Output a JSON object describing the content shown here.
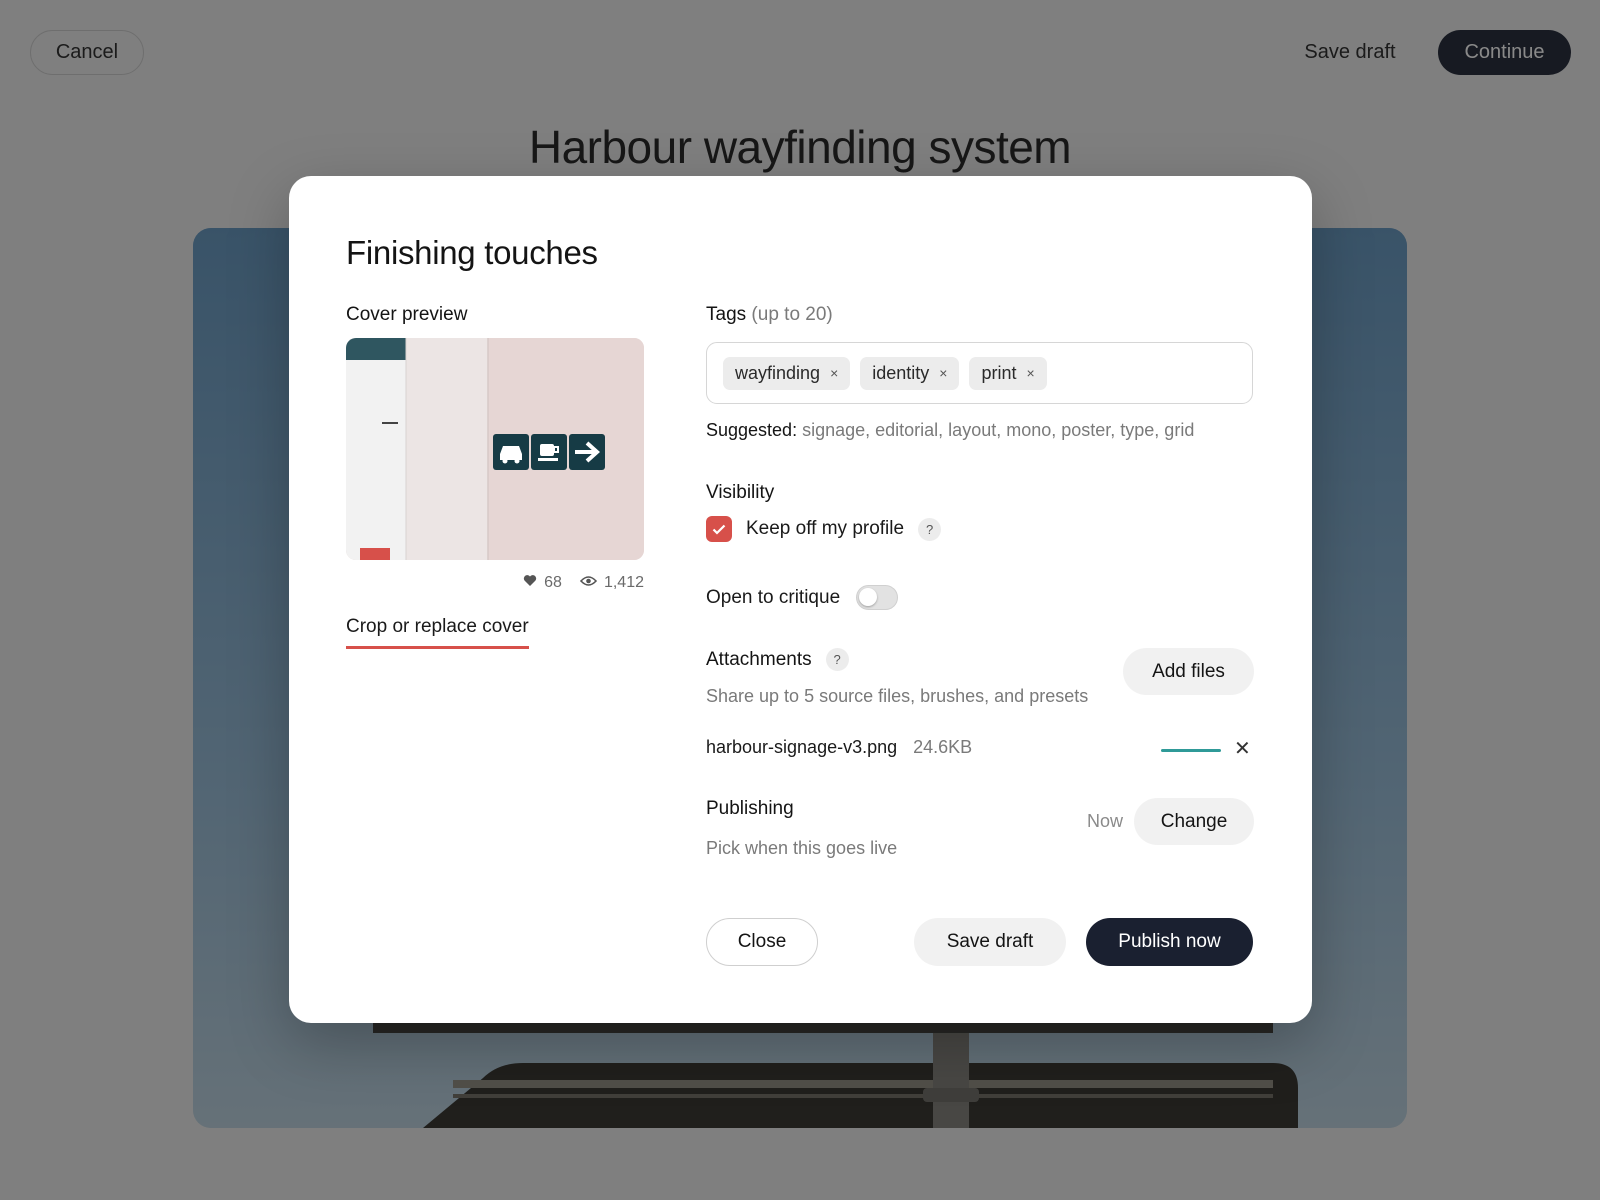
{
  "topbar": {
    "cancel_label": "Cancel",
    "save_draft_label": "Save draft",
    "continue_label": "Continue"
  },
  "project": {
    "title": "Harbour wayfinding system"
  },
  "modal": {
    "title": "Finishing touches",
    "cover": {
      "label": "Cover preview",
      "likes": "68",
      "views": "1,412",
      "crop_link": "Crop or replace cover"
    },
    "tags": {
      "label": "Tags",
      "hint": "(up to 20)",
      "items": [
        "wayfinding",
        "identity",
        "print"
      ],
      "remove_glyph": "×",
      "suggested_label": "Suggested:",
      "suggested_values": "signage, editorial, layout, mono, poster, type, grid"
    },
    "visibility": {
      "label": "Visibility",
      "keep_off_profile_label": "Keep off my profile",
      "keep_off_profile_checked": true,
      "help_glyph": "?",
      "open_to_critique_label": "Open to critique",
      "open_to_critique_on": false
    },
    "attachments": {
      "label": "Attachments",
      "help_glyph": "?",
      "description": "Share up to 5 source files, brushes, and presets",
      "add_files_label": "Add files",
      "files": [
        {
          "name": "harbour-signage-v3.png",
          "size": "24.6KB",
          "progress": 1.0
        }
      ],
      "remove_glyph": "✕"
    },
    "publishing": {
      "label": "Publishing",
      "description": "Pick when this goes live",
      "value": "Now",
      "change_label": "Change"
    },
    "footer": {
      "close_label": "Close",
      "save_draft_label": "Save draft",
      "publish_label": "Publish now"
    }
  },
  "colors": {
    "accent": "#d7504a",
    "primary_dark": "#1a2030",
    "progress": "#2f9a98"
  }
}
